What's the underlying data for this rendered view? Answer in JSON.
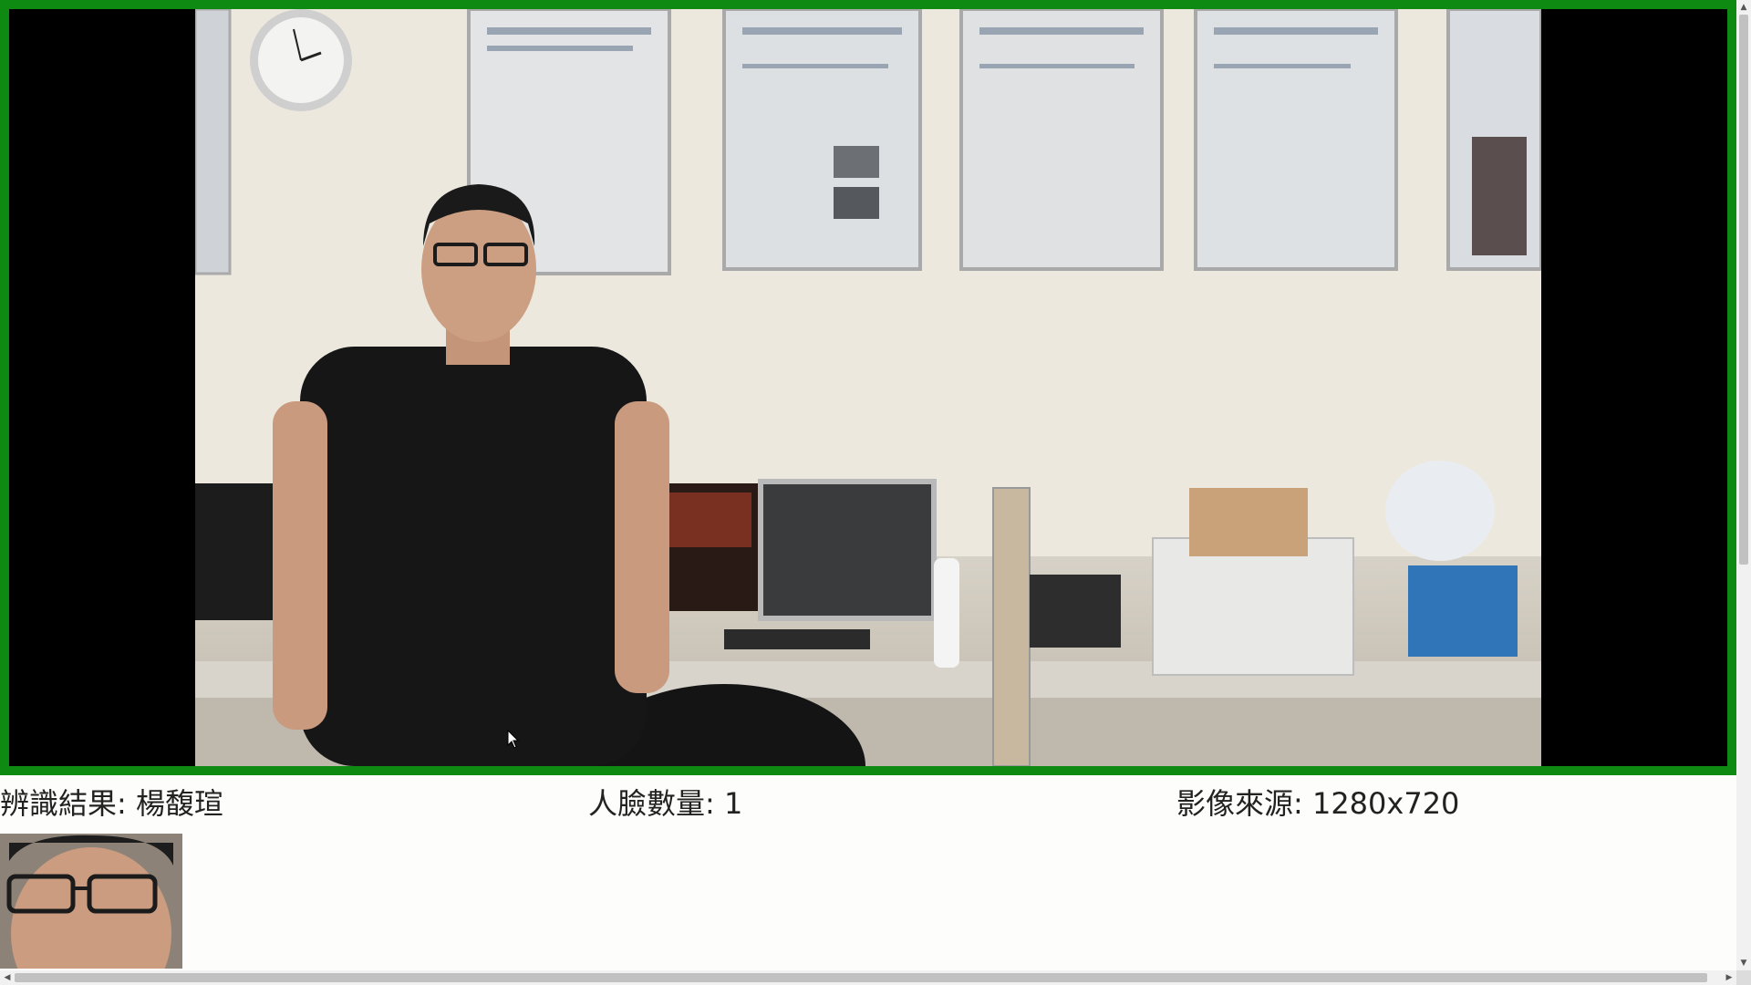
{
  "info": {
    "recognition": "辨識結果: 楊馥瑄",
    "face_count": "人臉數量: 1",
    "source": "影像來源: 1280x720"
  },
  "colors": {
    "frame_border": "#0e8a12",
    "letterbox": "#000000",
    "page_bg": "#fdfdfb"
  },
  "icons": {
    "cursor": "mouse-pointer-icon",
    "scroll_up": "chevron-up-icon",
    "scroll_down": "chevron-down-icon",
    "scroll_left": "chevron-left-icon",
    "scroll_right": "chevron-right-icon"
  },
  "scrollbars": {
    "arrow_up": "▲",
    "arrow_down": "▼",
    "arrow_left": "◀",
    "arrow_right": "▶"
  }
}
